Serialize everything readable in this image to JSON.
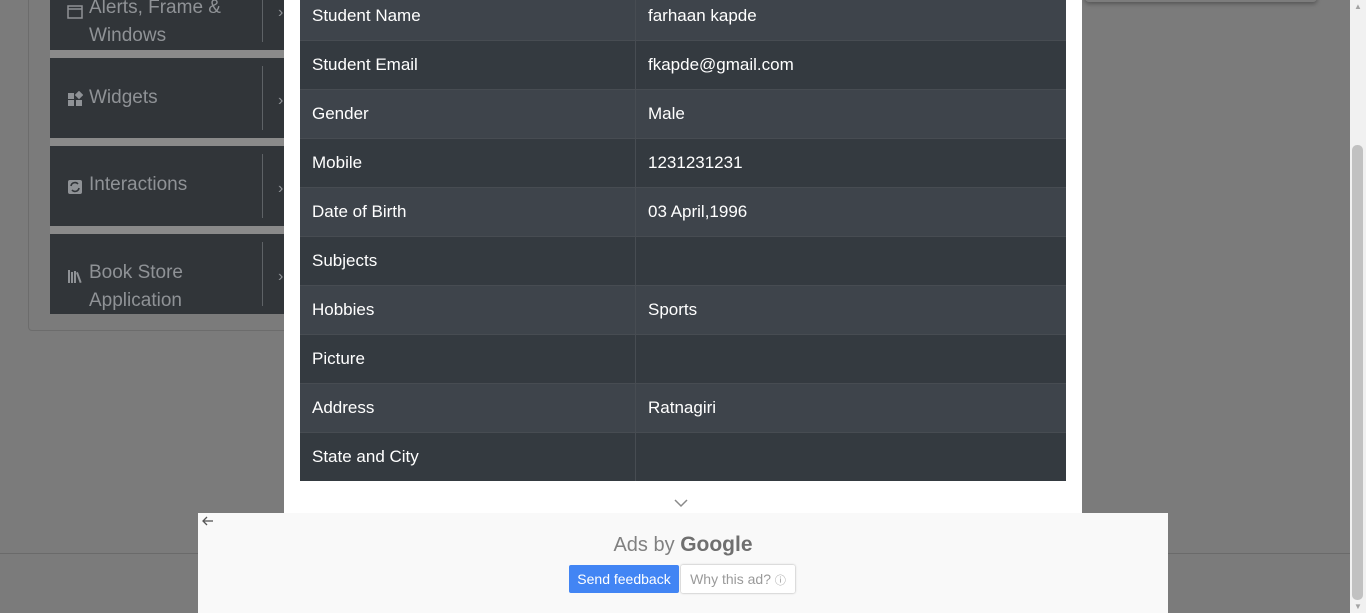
{
  "sidebar": {
    "groups": [
      {
        "label_line1": "Alerts, Frame &",
        "label_line2": "Windows",
        "icon": "window-icon"
      },
      {
        "label_line1": "Widgets",
        "label_line2": "",
        "icon": "widgets-icon"
      },
      {
        "label_line1": "Interactions",
        "label_line2": "",
        "icon": "interactions-icon"
      },
      {
        "label_line1": "Book Store",
        "label_line2": "Application",
        "icon": "books-icon"
      }
    ]
  },
  "results": {
    "rows": [
      {
        "label": "Student Name",
        "value": "farhaan kapde"
      },
      {
        "label": "Student Email",
        "value": "fkapde@gmail.com"
      },
      {
        "label": "Gender",
        "value": "Male"
      },
      {
        "label": "Mobile",
        "value": "1231231231"
      },
      {
        "label": "Date of Birth",
        "value": "03 April,1996"
      },
      {
        "label": "Subjects",
        "value": ""
      },
      {
        "label": "Hobbies",
        "value": "Sports"
      },
      {
        "label": "Picture",
        "value": ""
      },
      {
        "label": "Address",
        "value": "Ratnagiri"
      },
      {
        "label": "State and City",
        "value": ""
      }
    ]
  },
  "ad": {
    "ads_by": "Ads by",
    "google": "Google",
    "send_feedback": "Send feedback",
    "why_this_ad": "Why this ad?",
    "info_icon": "ⓘ"
  },
  "colors": {
    "table_dark": "#343a40",
    "table_light": "#3e444b",
    "ad_button": "#4285f4"
  }
}
